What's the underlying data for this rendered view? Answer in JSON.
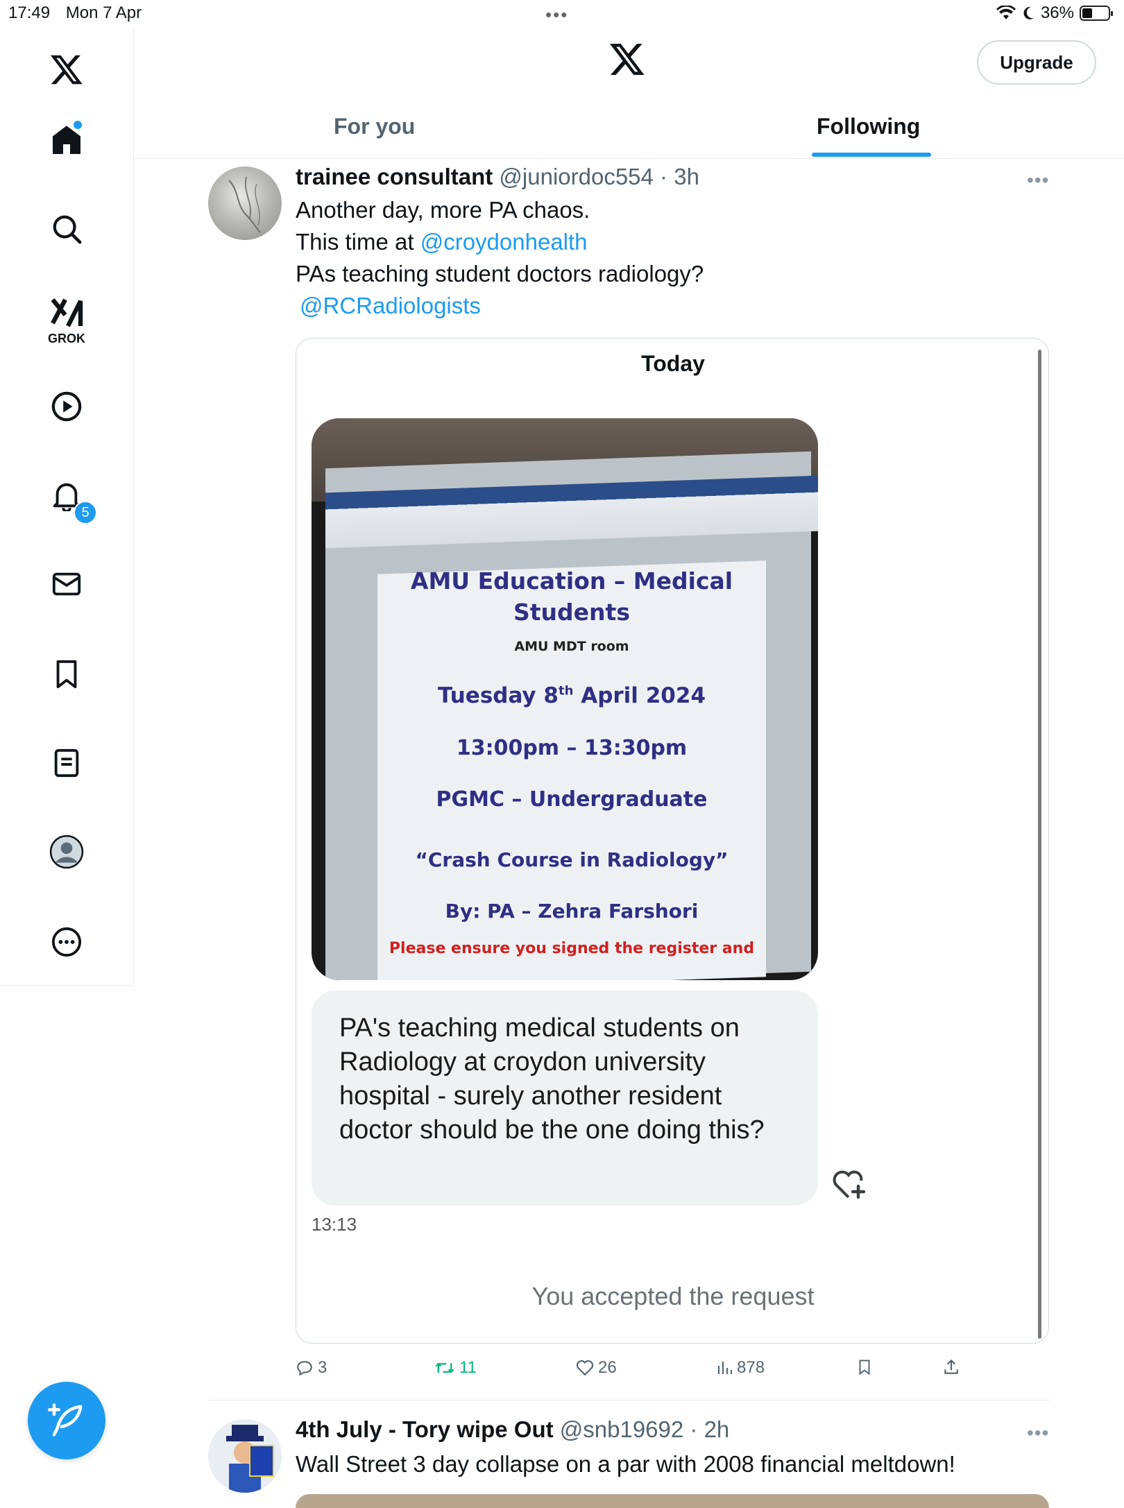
{
  "status_bar": {
    "time": "17:49",
    "date": "Mon 7 Apr",
    "battery": "36%"
  },
  "sidebar": {
    "grok_label": "GROK",
    "notifications_badge": "5"
  },
  "header": {
    "upgrade_label": "Upgrade"
  },
  "tabs": [
    {
      "label": "For you",
      "active": false
    },
    {
      "label": "Following",
      "active": true
    }
  ],
  "tweet1": {
    "name": "trainee consultant",
    "handle": "@juniordoc554",
    "time": "3h",
    "lines": [
      "Another day, more PA chaos.",
      "This time at",
      "PAs teaching student doctors radiology?"
    ],
    "mention1": "@croydonhealth",
    "mention2": "@RCRadiologists",
    "media": {
      "today_label": "Today",
      "photo": {
        "title1": "AMU Education – Medical",
        "title2": "Students",
        "room": "AMU MDT room",
        "date_prefix": "Tuesday 8",
        "date_sup": "th",
        "date_suffix": " April 2024",
        "time": "13:00pm – 13:30pm",
        "dept": "PGMC – Undergraduate",
        "course": "“Crash Course in Radiology”",
        "by": "By: PA – Zehra Farshori",
        "footer": "Please ensure you signed the register and"
      },
      "message": "PA's teaching medical students on Radiology at croydon university hospital - surely another resident doctor should be the one doing this?",
      "message_time": "13:13",
      "accepted": "You accepted the request"
    },
    "stats": {
      "replies": "3",
      "reposts": "11",
      "likes": "26",
      "views": "878"
    }
  },
  "tweet2": {
    "name": "4th July - Tory wipe Out",
    "handle": "@snb19692",
    "time": "2h",
    "text": "Wall Street 3 day collapse on a par with 2008 financial meltdown!"
  },
  "colors": {
    "accent": "#1d9bf0",
    "repost_green": "#00ba7c",
    "muted": "#536471"
  }
}
